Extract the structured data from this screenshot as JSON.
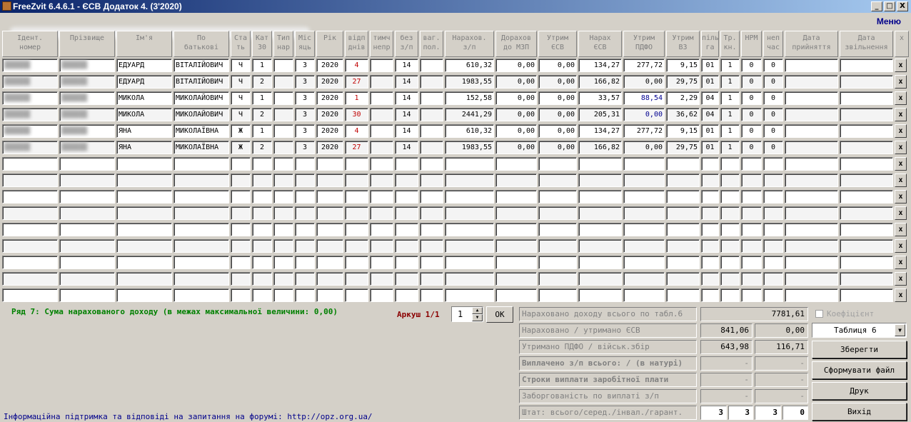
{
  "window": {
    "title": "FreeZvit 6.4.6.1 - ЄСВ Додаток 4. (3'2020)",
    "menu": "Меню",
    "buttons": [
      "_",
      "□",
      "X"
    ]
  },
  "columns": [
    "Ідент.\nномер",
    "Прізвище",
    "Ім'я",
    "По\nбатькові",
    "Ста\nть",
    "Кат\n30",
    "Тип\nнар",
    "Міс\nяць",
    "Рік",
    "відп\nднів",
    "тимч\nнепр",
    "без\nз/п",
    "ваг.\nпол.",
    "Нарахов.\nз/п",
    "Дорахов\nдо МЗП",
    "Утрим\nЄСВ",
    "Нарах\nЄСВ",
    "Утрим\nПДФО",
    "Утрим\nВЗ",
    "піль\nга",
    "Тр.\nкн.",
    "НРМ",
    "неп\nчас",
    "Дата\nприйняття",
    "Дата\nзвільнення",
    "x"
  ],
  "rows": [
    [
      "",
      "",
      "ЕДУАРД",
      "ВІТАЛІЙОВИЧ",
      "Ч",
      "1",
      "",
      "3",
      "2020",
      "4",
      "",
      "14",
      "",
      "610,32",
      "0,00",
      "0,00",
      "134,27",
      "277,72",
      "9,15",
      "01",
      "1",
      "0",
      "0",
      "",
      ""
    ],
    [
      "",
      "",
      "ЕДУАРД",
      "ВІТАЛІЙОВИЧ",
      "Ч",
      "2",
      "",
      "3",
      "2020",
      "27",
      "",
      "14",
      "",
      "1983,55",
      "0,00",
      "0,00",
      "166,82",
      "0,00",
      "29,75",
      "01",
      "1",
      "0",
      "0",
      "",
      ""
    ],
    [
      "",
      "",
      "МИКОЛА",
      "МИКОЛАЙОВИЧ",
      "Ч",
      "1",
      "",
      "3",
      "2020",
      "1",
      "",
      "14",
      "",
      "152,58",
      "0,00",
      "0,00",
      "33,57",
      "88,54",
      "2,29",
      "04",
      "1",
      "0",
      "0",
      "",
      ""
    ],
    [
      "",
      "",
      "МИКОЛА",
      "МИКОЛАЙОВИЧ",
      "Ч",
      "2",
      "",
      "3",
      "2020",
      "30",
      "",
      "14",
      "",
      "2441,29",
      "0,00",
      "0,00",
      "205,31",
      "0,00",
      "36,62",
      "04",
      "1",
      "0",
      "0",
      "",
      ""
    ],
    [
      "",
      "",
      "ЯНА",
      "МИКОЛАЇВНА",
      "Ж",
      "1",
      "",
      "3",
      "2020",
      "4",
      "",
      "14",
      "",
      "610,32",
      "0,00",
      "0,00",
      "134,27",
      "277,72",
      "9,15",
      "01",
      "1",
      "0",
      "0",
      "",
      ""
    ],
    [
      "",
      "",
      "ЯНА",
      "МИКОЛАЇВНА",
      "Ж",
      "2",
      "",
      "3",
      "2020",
      "27",
      "",
      "14",
      "",
      "1983,55",
      "0,00",
      "0,00",
      "166,82",
      "0,00",
      "29,75",
      "01",
      "1",
      "0",
      "0",
      "",
      ""
    ]
  ],
  "row_delete_label": "x",
  "status": "Ряд 7: Сума нарахованого доходу (в межах максимальної величини: 0,00)",
  "sheet": {
    "label": "Аркуш 1/1",
    "value": "1",
    "ok": "ОК"
  },
  "summary": {
    "income_label": "Нараховано доходу всього по табл.6",
    "income": "7781,61",
    "esv_label": "Нараховано / утримано ЄСВ",
    "esv_accrued": "841,06",
    "esv_withheld": "0,00",
    "pdfo_label": "Утримано ПДФО / військ.збір",
    "pdfo": "643,98",
    "vz": "116,71",
    "paid_label": "Виплачено з/п всього: / (в натурі)",
    "paid": "-",
    "paid_nat": "-",
    "terms_label": "Строки виплати заробітної плати",
    "terms1": "-",
    "terms2": "-",
    "debt_label": "Заборгованість по виплаті з/п",
    "debt1": "-",
    "debt2": "-",
    "staff_label": "Штат: всього/серед./інвал./гарант.",
    "staff": [
      "3",
      "3",
      "3",
      "0"
    ]
  },
  "coef_label": "Коефіцієнт",
  "table_select": "Таблиця 6",
  "actions": {
    "save": "Зберегти",
    "form": "Сформувати файл",
    "print": "Друк",
    "exit": "Вихід"
  },
  "footer": "Інформаційна підтримка та відповіді на запитання на форумі: http://opz.org.ua/",
  "colors": {
    "title": "#0a246a",
    "status": "#008000",
    "sheet": "#8b0000",
    "red": "#c00000",
    "blue": "#000090"
  }
}
